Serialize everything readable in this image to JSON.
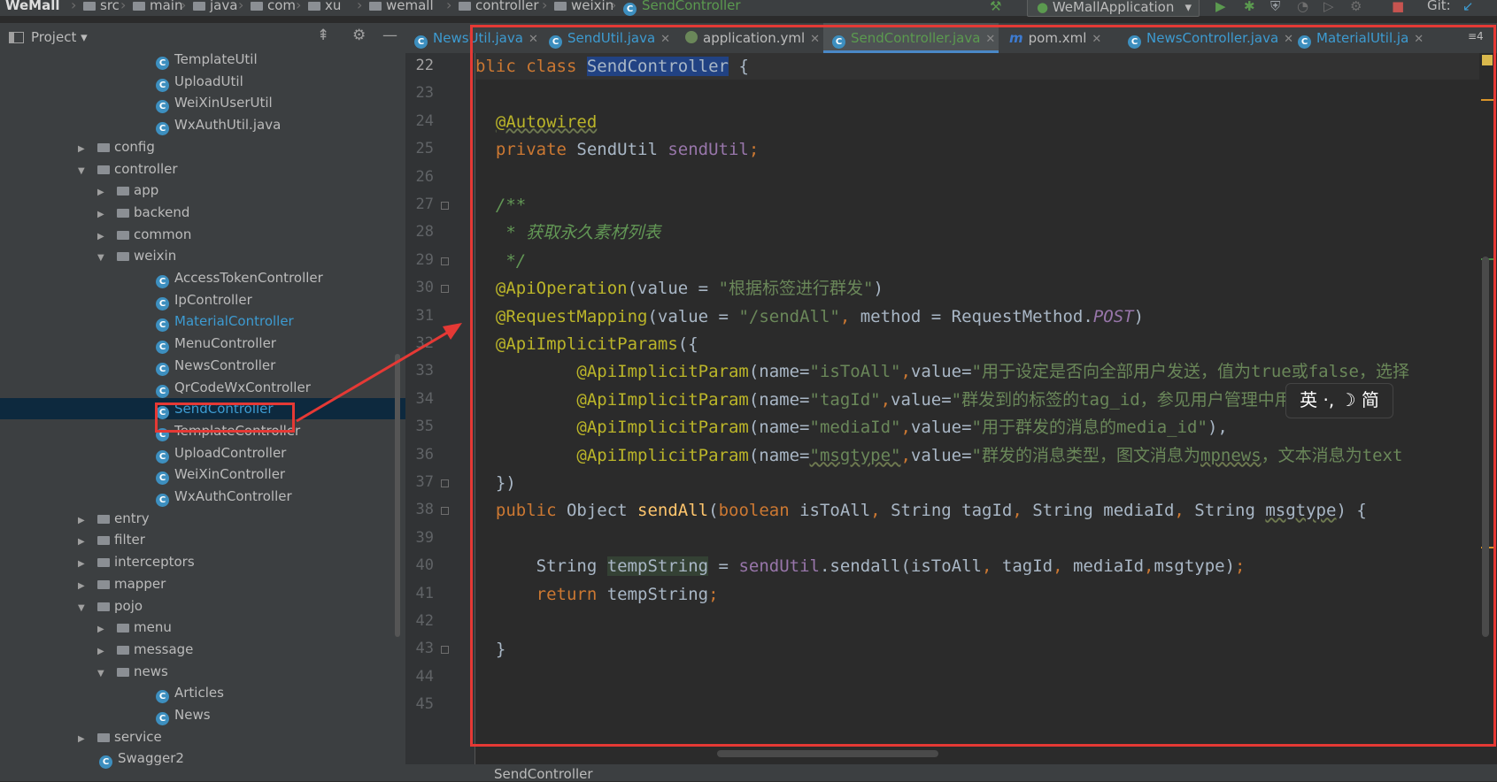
{
  "nav": {
    "crumbs": [
      "WeMall",
      "src",
      "main",
      "java",
      "com",
      "xu",
      "wemall",
      "controller",
      "weixin",
      "SendController"
    ],
    "run_config": "WeMallApplication",
    "git_label": "Git:"
  },
  "project_panel": {
    "title": "Project",
    "tree": [
      {
        "label": "TemplateUtil",
        "type": "class",
        "depth": 4
      },
      {
        "label": "UploadUtil",
        "type": "class",
        "depth": 4
      },
      {
        "label": "WeiXinUserUtil",
        "type": "class",
        "depth": 4
      },
      {
        "label": "WxAuthUtil.java",
        "type": "class",
        "depth": 4
      },
      {
        "label": "config",
        "type": "folder",
        "depth": 2,
        "expanded": false
      },
      {
        "label": "controller",
        "type": "folder",
        "depth": 2,
        "expanded": true
      },
      {
        "label": "app",
        "type": "folder",
        "depth": 3,
        "expanded": false
      },
      {
        "label": "backend",
        "type": "folder",
        "depth": 3,
        "expanded": false
      },
      {
        "label": "common",
        "type": "folder",
        "depth": 3,
        "expanded": false
      },
      {
        "label": "weixin",
        "type": "folder",
        "depth": 3,
        "expanded": true
      },
      {
        "label": "AccessTokenController",
        "type": "class",
        "depth": 4
      },
      {
        "label": "IpController",
        "type": "class",
        "depth": 4
      },
      {
        "label": "MaterialController",
        "type": "class",
        "depth": 4,
        "modified": true
      },
      {
        "label": "MenuController",
        "type": "class",
        "depth": 4
      },
      {
        "label": "NewsController",
        "type": "class",
        "depth": 4
      },
      {
        "label": "QrCodeWxController",
        "type": "class",
        "depth": 4
      },
      {
        "label": "SendController",
        "type": "class",
        "depth": 4,
        "selected": true,
        "modified": true
      },
      {
        "label": "TemplateController",
        "type": "class",
        "depth": 4
      },
      {
        "label": "UploadController",
        "type": "class",
        "depth": 4
      },
      {
        "label": "WeiXinController",
        "type": "class",
        "depth": 4
      },
      {
        "label": "WxAuthController",
        "type": "class",
        "depth": 4
      },
      {
        "label": "entry",
        "type": "folder",
        "depth": 2,
        "expanded": false
      },
      {
        "label": "filter",
        "type": "folder",
        "depth": 2,
        "expanded": false
      },
      {
        "label": "interceptors",
        "type": "folder",
        "depth": 2,
        "expanded": false
      },
      {
        "label": "mapper",
        "type": "folder",
        "depth": 2,
        "expanded": false
      },
      {
        "label": "pojo",
        "type": "folder",
        "depth": 2,
        "expanded": true
      },
      {
        "label": "menu",
        "type": "folder",
        "depth": 3,
        "expanded": false
      },
      {
        "label": "message",
        "type": "folder",
        "depth": 3,
        "expanded": false
      },
      {
        "label": "news",
        "type": "folder",
        "depth": 3,
        "expanded": true
      },
      {
        "label": "Articles",
        "type": "class",
        "depth": 4
      },
      {
        "label": "News",
        "type": "class",
        "depth": 4
      },
      {
        "label": "service",
        "type": "folder",
        "depth": 2,
        "expanded": false
      },
      {
        "label": "Swagger2",
        "type": "class",
        "depth": 2
      }
    ]
  },
  "tabs": [
    {
      "label": "NewsUtil.java",
      "kind": "java"
    },
    {
      "label": "SendUtil.java",
      "kind": "java"
    },
    {
      "label": "application.yml",
      "kind": "yml"
    },
    {
      "label": "SendController.java",
      "kind": "java",
      "active": true
    },
    {
      "label": "pom.xml",
      "kind": "maven"
    },
    {
      "label": "NewsController.java",
      "kind": "java"
    },
    {
      "label": "MaterialUtil.ja",
      "kind": "java"
    }
  ],
  "tabs_overflow": "≡4",
  "editor": {
    "line_numbers": [
      "22",
      "23",
      "24",
      "25",
      "26",
      "27",
      "28",
      "29",
      "30",
      "31",
      "32",
      "33",
      "34",
      "35",
      "36",
      "37",
      "38",
      "39",
      "40",
      "41",
      "42",
      "43",
      "44",
      "45"
    ],
    "current_line": "22",
    "lines": [
      [
        {
          "t": "blic ",
          "c": "kw"
        },
        {
          "t": "class ",
          "c": "kw"
        },
        {
          "t": "SendController",
          "c": "hlsel"
        },
        {
          "t": " {",
          "c": ""
        }
      ],
      [],
      [
        {
          "t": "  ",
          "c": ""
        },
        {
          "t": "@Autowired",
          "c": "an wavy"
        }
      ],
      [
        {
          "t": "  ",
          "c": ""
        },
        {
          "t": "private ",
          "c": "kw"
        },
        {
          "t": "SendUtil ",
          "c": ""
        },
        {
          "t": "sendUtil",
          "c": "fld"
        },
        {
          "t": ";",
          "c": "kw"
        }
      ],
      [],
      [
        {
          "t": "  ",
          "c": ""
        },
        {
          "t": "/**",
          "c": "cmt"
        }
      ],
      [
        {
          "t": "   ",
          "c": ""
        },
        {
          "t": "* 获取永久素材列表",
          "c": "cmt"
        }
      ],
      [
        {
          "t": "   ",
          "c": ""
        },
        {
          "t": "*/",
          "c": "cmt"
        }
      ],
      [
        {
          "t": "  ",
          "c": ""
        },
        {
          "t": "@ApiOperation",
          "c": "an"
        },
        {
          "t": "(value = ",
          "c": ""
        },
        {
          "t": "\"根据标签进行群发\"",
          "c": "str"
        },
        {
          "t": ")",
          "c": ""
        }
      ],
      [
        {
          "t": "  ",
          "c": ""
        },
        {
          "t": "@RequestMapping",
          "c": "an"
        },
        {
          "t": "(value = ",
          "c": ""
        },
        {
          "t": "\"/sendAll\"",
          "c": "str"
        },
        {
          "t": ", ",
          "c": "kw"
        },
        {
          "t": "method = RequestMethod.",
          "c": ""
        },
        {
          "t": "POST",
          "c": "st"
        },
        {
          "t": ")",
          "c": ""
        }
      ],
      [
        {
          "t": "  ",
          "c": ""
        },
        {
          "t": "@ApiImplicitParams",
          "c": "an"
        },
        {
          "t": "({",
          "c": ""
        }
      ],
      [
        {
          "t": "          ",
          "c": ""
        },
        {
          "t": "@ApiImplicitParam",
          "c": "an"
        },
        {
          "t": "(name=",
          "c": ""
        },
        {
          "t": "\"isToAll\"",
          "c": "str"
        },
        {
          "t": ",",
          "c": "kw"
        },
        {
          "t": "value=",
          "c": ""
        },
        {
          "t": "\"用于设定是否向全部用户发送，值为true或false，选择",
          "c": "str"
        }
      ],
      [
        {
          "t": "          ",
          "c": ""
        },
        {
          "t": "@ApiImplicitParam",
          "c": "an"
        },
        {
          "t": "(name=",
          "c": ""
        },
        {
          "t": "\"tagId\"",
          "c": "str"
        },
        {
          "t": ",",
          "c": "kw"
        },
        {
          "t": "value=",
          "c": ""
        },
        {
          "t": "\"群发到的标签的tag_id，参见用户管理中用户分组接口",
          "c": "str"
        }
      ],
      [
        {
          "t": "          ",
          "c": ""
        },
        {
          "t": "@ApiImplicitParam",
          "c": "an"
        },
        {
          "t": "(name=",
          "c": ""
        },
        {
          "t": "\"mediaId\"",
          "c": "str"
        },
        {
          "t": ",",
          "c": "kw"
        },
        {
          "t": "value=",
          "c": ""
        },
        {
          "t": "\"用于群发的消息的media_id\"",
          "c": "str"
        },
        {
          "t": "),",
          "c": ""
        }
      ],
      [
        {
          "t": "          ",
          "c": ""
        },
        {
          "t": "@ApiImplicitParam",
          "c": "an"
        },
        {
          "t": "(name=",
          "c": ""
        },
        {
          "t": "\"msgtype\"",
          "c": "str wavy"
        },
        {
          "t": ",",
          "c": "kw"
        },
        {
          "t": "value=",
          "c": ""
        },
        {
          "t": "\"群发的消息类型，图文消息为",
          "c": "str"
        },
        {
          "t": "mpnews",
          "c": "str wavy"
        },
        {
          "t": "，文本消息为text",
          "c": "str"
        }
      ],
      [
        {
          "t": "  })",
          "c": ""
        }
      ],
      [
        {
          "t": "  ",
          "c": ""
        },
        {
          "t": "public ",
          "c": "kw"
        },
        {
          "t": "Object ",
          "c": ""
        },
        {
          "t": "sendAll",
          "c": "mth"
        },
        {
          "t": "(",
          "c": ""
        },
        {
          "t": "boolean ",
          "c": "kw"
        },
        {
          "t": "isToAll",
          "c": ""
        },
        {
          "t": ", ",
          "c": "kw"
        },
        {
          "t": "String tagId",
          "c": ""
        },
        {
          "t": ", ",
          "c": "kw"
        },
        {
          "t": "String mediaId",
          "c": ""
        },
        {
          "t": ", ",
          "c": "kw"
        },
        {
          "t": "String ",
          "c": ""
        },
        {
          "t": "msgtype",
          "c": "wavy"
        },
        {
          "t": ") {",
          "c": ""
        }
      ],
      [],
      [
        {
          "t": "      String ",
          "c": ""
        },
        {
          "t": "tempString",
          "c": "hlvar"
        },
        {
          "t": " = ",
          "c": ""
        },
        {
          "t": "sendUtil",
          "c": "fld"
        },
        {
          "t": ".sendall(isToAll",
          "c": ""
        },
        {
          "t": ", ",
          "c": "kw"
        },
        {
          "t": "tagId",
          "c": ""
        },
        {
          "t": ", ",
          "c": "kw"
        },
        {
          "t": "mediaId",
          "c": ""
        },
        {
          "t": ",",
          "c": "kw"
        },
        {
          "t": "msgtype)",
          "c": ""
        },
        {
          "t": ";",
          "c": "kw"
        }
      ],
      [
        {
          "t": "      ",
          "c": ""
        },
        {
          "t": "return ",
          "c": "kw"
        },
        {
          "t": "tempString",
          "c": ""
        },
        {
          "t": ";",
          "c": "kw"
        }
      ],
      [],
      [
        {
          "t": "  }",
          "c": ""
        }
      ],
      [],
      []
    ]
  },
  "ime": {
    "text": "英 ·, ☽ 简"
  },
  "breadcrumb_bottom": "SendController",
  "colors": {
    "selection_box": "#e53935",
    "keyword": "#cc7832",
    "string": "#6a8759",
    "annotation": "#bbb529"
  }
}
